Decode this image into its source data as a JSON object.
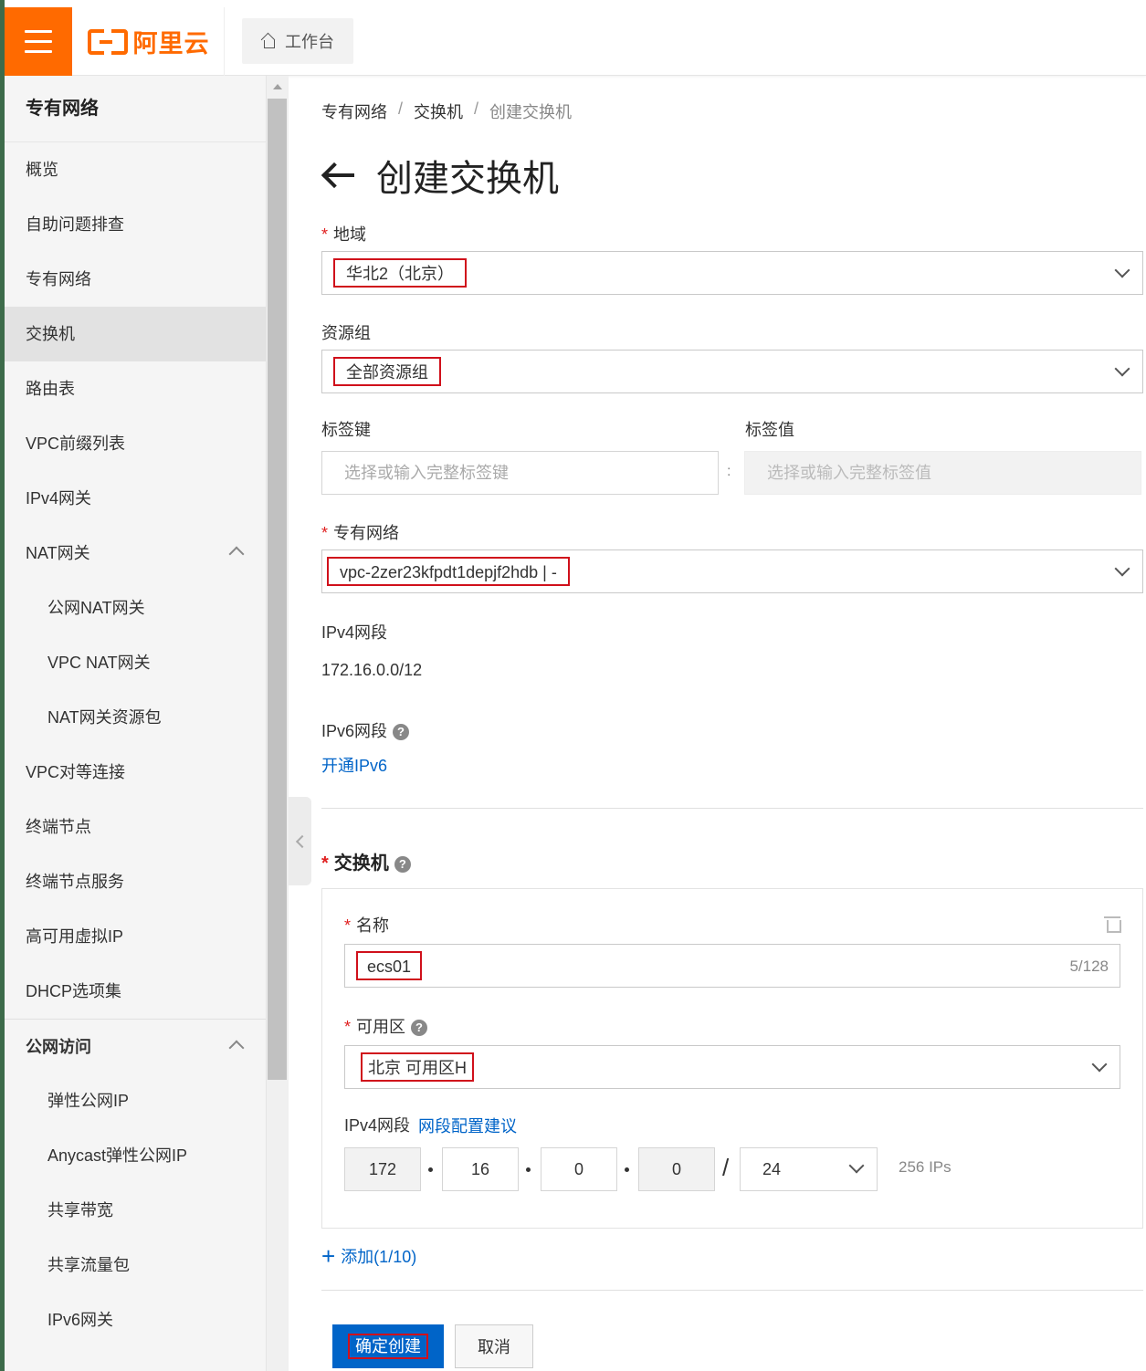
{
  "header": {
    "logo_text": "阿里云",
    "workbench_label": "工作台"
  },
  "sidebar": {
    "title": "专有网络",
    "items": [
      {
        "label": "概览"
      },
      {
        "label": "自助问题排查"
      },
      {
        "label": "专有网络"
      },
      {
        "label": "交换机",
        "active": true
      },
      {
        "label": "路由表"
      },
      {
        "label": "VPC前缀列表"
      },
      {
        "label": "IPv4网关"
      },
      {
        "label": "NAT网关",
        "expanded": true
      },
      {
        "label": "公网NAT网关",
        "sub": true
      },
      {
        "label": "VPC NAT网关",
        "sub": true
      },
      {
        "label": "NAT网关资源包",
        "sub": true
      },
      {
        "label": "VPC对等连接"
      },
      {
        "label": "终端节点"
      },
      {
        "label": "终端节点服务"
      },
      {
        "label": "高可用虚拟IP"
      },
      {
        "label": "DHCP选项集"
      },
      {
        "label": "公网访问",
        "group": true,
        "expanded": true
      },
      {
        "label": "弹性公网IP",
        "sub": true
      },
      {
        "label": "Anycast弹性公网IP",
        "sub": true
      },
      {
        "label": "共享带宽",
        "sub": true
      },
      {
        "label": "共享流量包",
        "sub": true
      },
      {
        "label": "IPv6网关",
        "sub": true
      }
    ]
  },
  "breadcrumb": [
    "专有网络",
    "交换机",
    "创建交换机"
  ],
  "page_title": "创建交换机",
  "form": {
    "region": {
      "label": "地域",
      "value": "华北2（北京）"
    },
    "resource_group": {
      "label": "资源组",
      "value": "全部资源组"
    },
    "tag_key": {
      "label": "标签键",
      "placeholder": "选择或输入完整标签键"
    },
    "tag_value": {
      "label": "标签值",
      "placeholder": "选择或输入完整标签值"
    },
    "vpc": {
      "label": "专有网络",
      "value": "vpc-2zer23kfpdt1depjf2hdb | -"
    },
    "ipv4_cidr": {
      "label": "IPv4网段",
      "value": "172.16.0.0/12"
    },
    "ipv6_cidr": {
      "label": "IPv6网段",
      "link": "开通IPv6"
    }
  },
  "vswitch": {
    "section_title": "交换机",
    "name": {
      "label": "名称",
      "value": "ecs01",
      "counter": "5/128"
    },
    "zone": {
      "label": "可用区",
      "value": "北京 可用区H"
    },
    "ipv4": {
      "label": "IPv4网段",
      "advice_link": "网段配置建议",
      "octets": [
        "172",
        "16",
        "0",
        "0"
      ],
      "mask": "24",
      "ip_count": "256 IPs"
    },
    "add_label": "添加(1/10)"
  },
  "actions": {
    "confirm": "确定创建",
    "cancel": "取消"
  },
  "colors": {
    "brand": "#ff6a00",
    "primary": "#0064c8",
    "highlight_border": "#d0101b"
  }
}
